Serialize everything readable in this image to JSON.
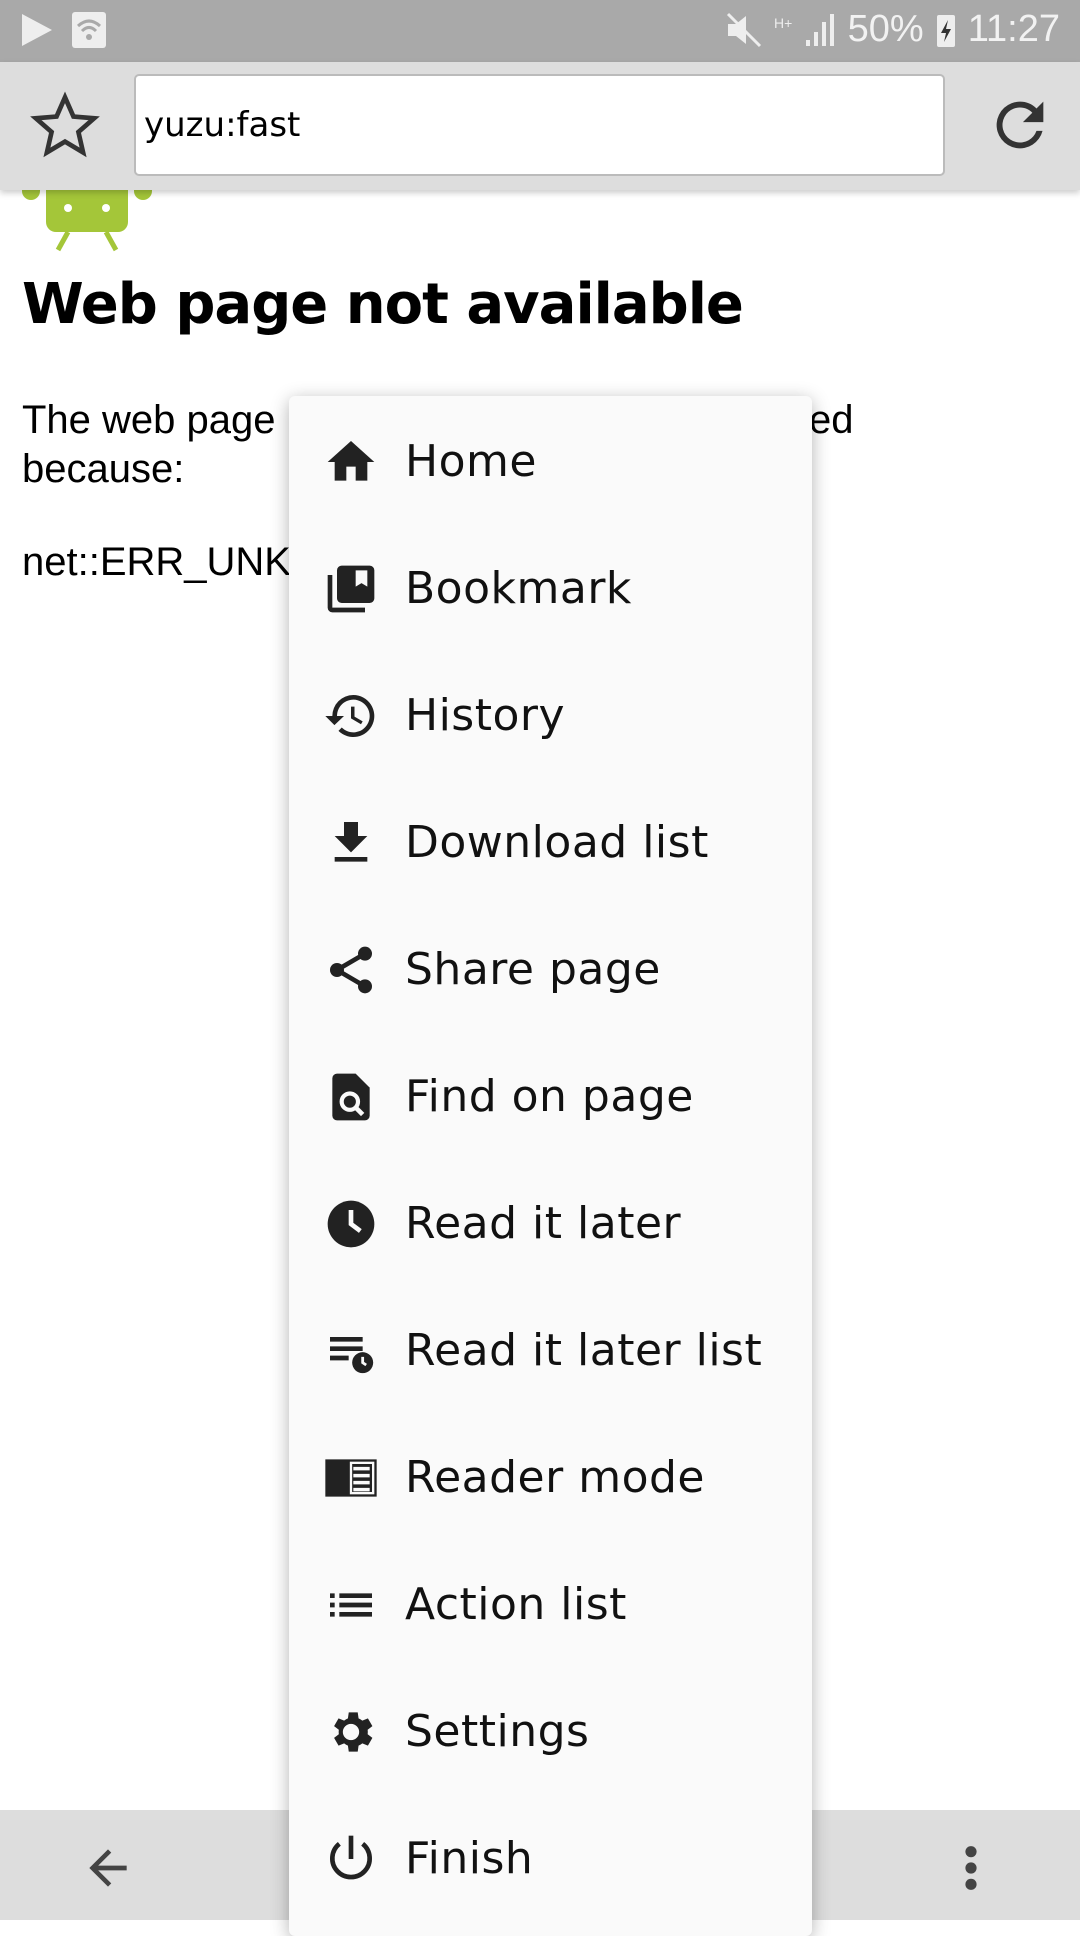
{
  "status_bar": {
    "battery": "50%",
    "time": "11:27",
    "icons": [
      "notification-icon",
      "wifi-icon",
      "mute-icon",
      "network-h-plus-icon",
      "signal-icon",
      "battery-charging-icon"
    ]
  },
  "toolbar": {
    "url": "yuzu:fast",
    "icons": [
      "star-icon",
      "reload-icon"
    ]
  },
  "page": {
    "title": "Web page not available",
    "message": "The web page                                            aded because:",
    "error": "net::ERR_UNKN"
  },
  "menu": {
    "items": [
      {
        "label": "Home",
        "icon": "home-icon"
      },
      {
        "label": "Bookmark",
        "icon": "bookmark-icon"
      },
      {
        "label": "History",
        "icon": "history-icon"
      },
      {
        "label": "Download list",
        "icon": "download-icon"
      },
      {
        "label": "Share page",
        "icon": "share-icon"
      },
      {
        "label": "Find on page",
        "icon": "find-icon"
      },
      {
        "label": "Read it later",
        "icon": "clock-icon"
      },
      {
        "label": "Read it later list",
        "icon": "list-clock-icon"
      },
      {
        "label": "Reader mode",
        "icon": "reader-icon"
      },
      {
        "label": "Action list",
        "icon": "list-icon"
      },
      {
        "label": "Settings",
        "icon": "gear-icon"
      },
      {
        "label": "Finish",
        "icon": "power-icon"
      }
    ]
  },
  "bottom_bar": {
    "icons": [
      "back-arrow-icon",
      "more-vert-icon"
    ]
  },
  "colors": {
    "status_bar": "#a9a9a9",
    "toolbar": "#dddddd",
    "menu_bg": "#fafafa",
    "android_green": "#a4c639"
  }
}
